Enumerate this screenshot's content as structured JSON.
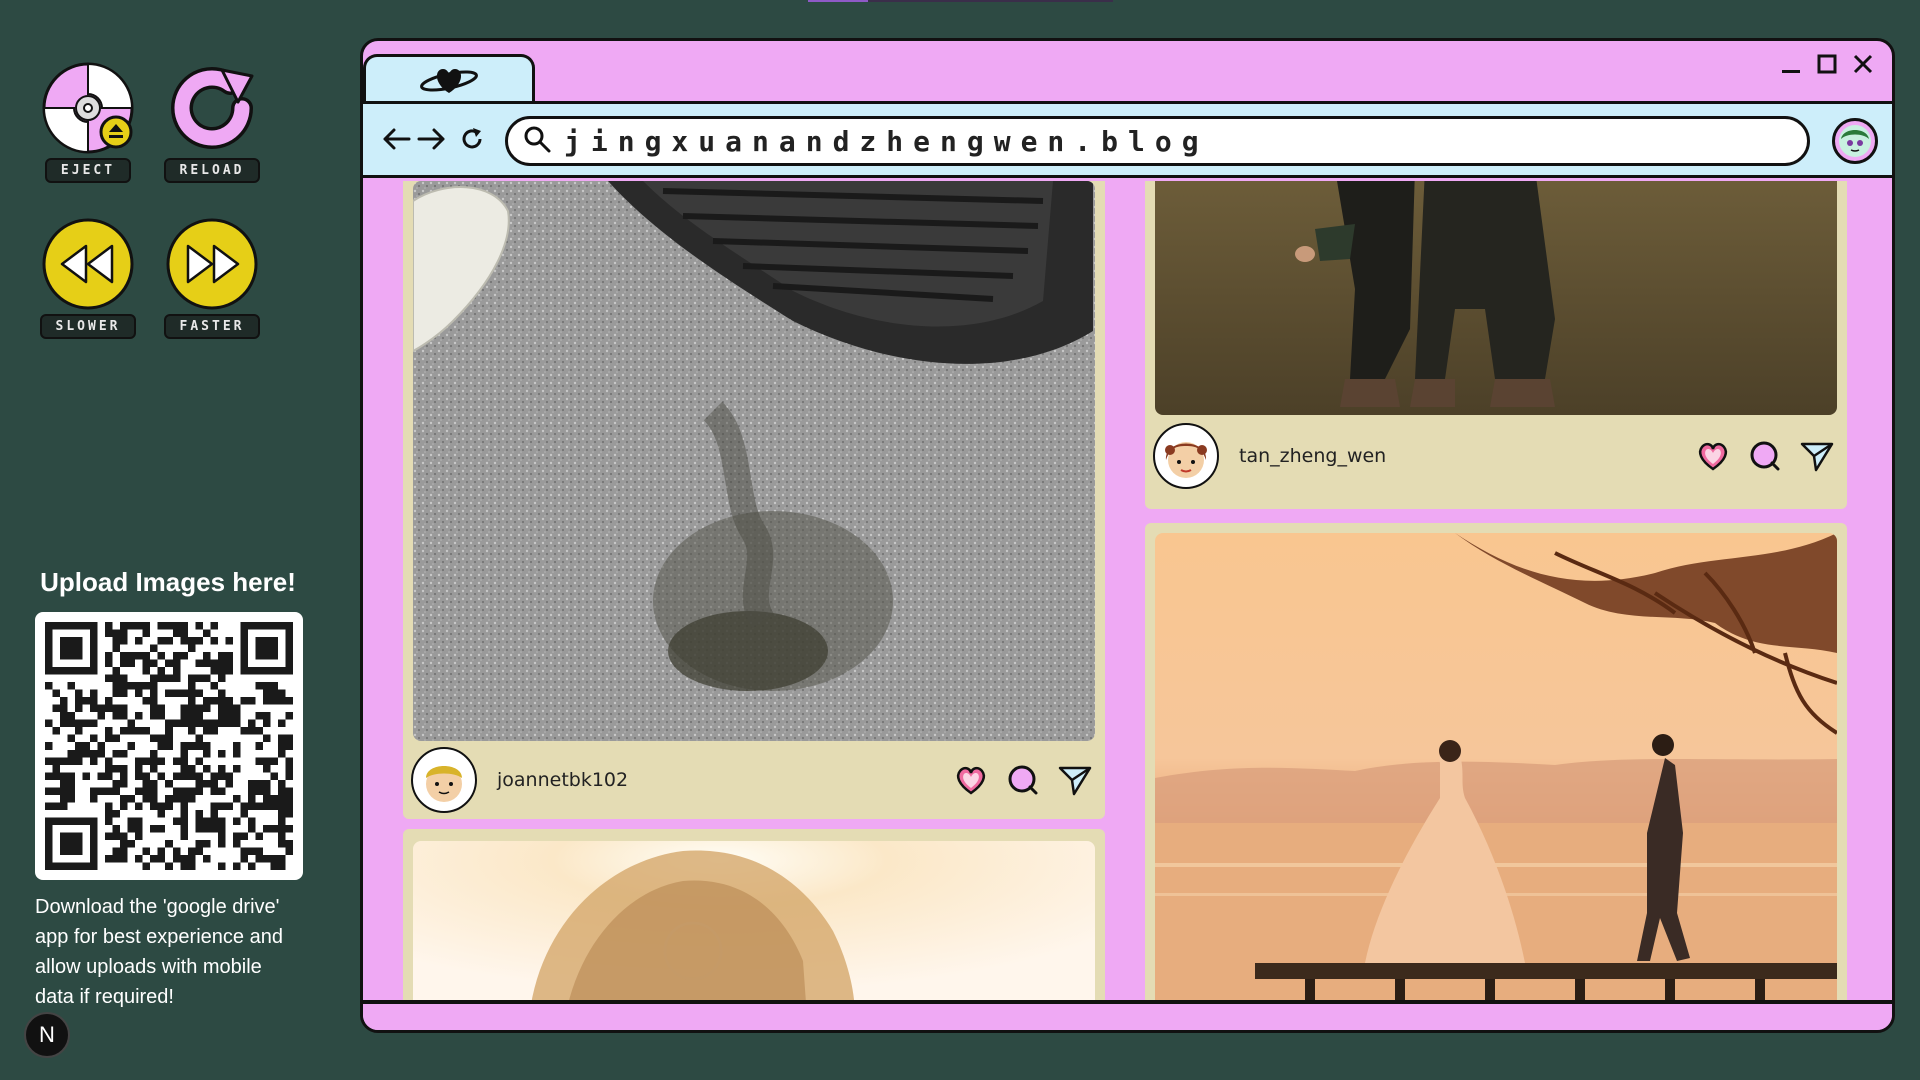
{
  "controls": {
    "eject": "EJECT",
    "reload": "RELOAD",
    "slower": "SLOWER",
    "faster": "FASTER"
  },
  "upload": {
    "title": "Upload Images here!",
    "note": "Download the 'google drive' app for best experience and allow uploads with mobile data if required!"
  },
  "badge": "N",
  "browser": {
    "url": "jingxuanandzhengwen.blog"
  },
  "posts": [
    {
      "username": "joannetbk102"
    },
    {
      "username": "tan_zheng_wen"
    }
  ],
  "colors": {
    "background": "#2d4a43",
    "window": "#efa9f4",
    "toolbar": "#cdeefa",
    "card": "#e4dcb4",
    "accent_yellow": "#e6cf17",
    "heart": "#f06aa0"
  }
}
